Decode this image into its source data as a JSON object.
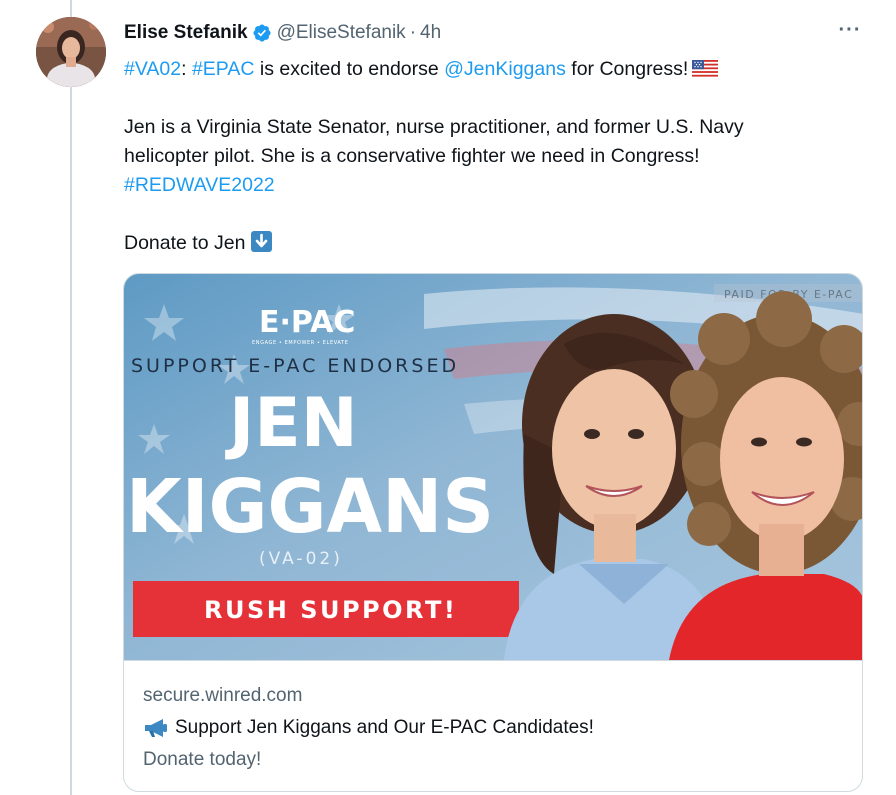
{
  "tweet": {
    "author_name": "Elise Stefanik",
    "author_handle": "@EliseStefanik",
    "separator": "·",
    "time": "4h",
    "more_label": "···",
    "line1": {
      "tag1": "#VA02",
      "colon": ":",
      "tag2": "#EPAC",
      "text1": " is excited to endorse ",
      "mention": "@JenKiggans",
      "text2": " for Congress!"
    },
    "line2": "Jen is a Virginia State Senator, nurse practitioner, and former U.S. Navy",
    "line3": "helicopter pilot. She is a conservative fighter we need in Congress!",
    "hashtag": "#REDWAVE2022",
    "donate_text": "Donate to Jen"
  },
  "card": {
    "ad": {
      "paid_for": "PAID FOR BY E-PAC",
      "logo": "E·PAC",
      "logo_tagline": "ENGAGE • EMPOWER • ELEVATE",
      "support": "SUPPORT E-PAC ENDORSED",
      "name_first": "JEN",
      "name_last": "KIGGANS",
      "district": "(VA-02)",
      "cta": "RUSH SUPPORT!"
    },
    "domain": "secure.winred.com",
    "title": "Support Jen Kiggans and Our E-PAC Candidates!",
    "description": "Donate today!"
  },
  "colors": {
    "link": "#1d9bf0",
    "secondary_text": "#536471",
    "verified": "#1d9bf0",
    "cta_red": "#e53238"
  }
}
